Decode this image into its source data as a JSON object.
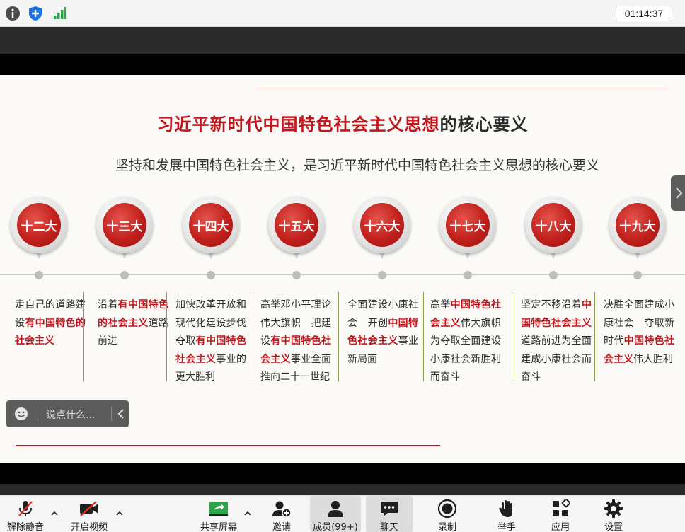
{
  "topbar": {
    "timer": "01:14:37",
    "icons": [
      "info-icon",
      "shield-icon",
      "signal-icon"
    ]
  },
  "slide": {
    "title_red": "习近平新时代中国特色社会主义思想",
    "title_dark": "的核心要义",
    "subtitle": "坚持和发展中国特色社会主义，是习近平新时代中国特色社会主义思想的核心要义",
    "congresses": [
      {
        "label": "十二大",
        "text": [
          {
            "t": "走自己的道路建设"
          },
          {
            "t": "有中国特色的社会主义",
            "hl": true
          }
        ]
      },
      {
        "label": "十三大",
        "text": [
          {
            "t": "沿着"
          },
          {
            "t": "有中国特色的社会主义",
            "hl": true
          },
          {
            "t": "道路前进"
          }
        ]
      },
      {
        "label": "十四大",
        "text": [
          {
            "t": "加快改革开放和现代化建设步伐　夺取"
          },
          {
            "t": "有中国特色社会主义",
            "hl": true
          },
          {
            "t": "事业的更大胜利"
          }
        ]
      },
      {
        "label": "十五大",
        "text": [
          {
            "t": "高举邓小平理论伟大旗帜　把建设"
          },
          {
            "t": "有中国特色社会主义",
            "hl": true
          },
          {
            "t": "事业全面推向二十一世纪"
          }
        ]
      },
      {
        "label": "十六大",
        "text": [
          {
            "t": "全面建设小康社会　开创"
          },
          {
            "t": "中国特色社会主义",
            "hl": true
          },
          {
            "t": "事业新局面"
          }
        ]
      },
      {
        "label": "十七大",
        "text": [
          {
            "t": "高举"
          },
          {
            "t": "中国特色社会主义",
            "hl": true
          },
          {
            "t": "伟大旗帜为夺取全面建设小康社会新胜利而奋斗"
          }
        ]
      },
      {
        "label": "十八大",
        "text": [
          {
            "t": "坚定不移沿着"
          },
          {
            "t": "中国特色社会主义",
            "hl": true
          },
          {
            "t": "道路前进为全面建成小康社会而奋斗"
          }
        ]
      },
      {
        "label": "十九大",
        "text": [
          {
            "t": "决胜全面建成小康社会　夺取新时代"
          },
          {
            "t": "中国特色社会主义",
            "hl": true
          },
          {
            "t": "伟大胜利"
          }
        ]
      }
    ]
  },
  "chat": {
    "placeholder": "说点什么..."
  },
  "toolbar": {
    "unmute": "解除静音",
    "start_video": "开启视频",
    "share_screen": "共享屏幕",
    "invite": "邀请",
    "members": "成员(99+)",
    "chat": "聊天",
    "record": "录制",
    "raise_hand": "举手",
    "apps": "应用",
    "settings": "设置"
  },
  "colors": {
    "accent_red": "#c0161d",
    "separator_green": "#8aa050",
    "share_green": "#2aa54a"
  }
}
